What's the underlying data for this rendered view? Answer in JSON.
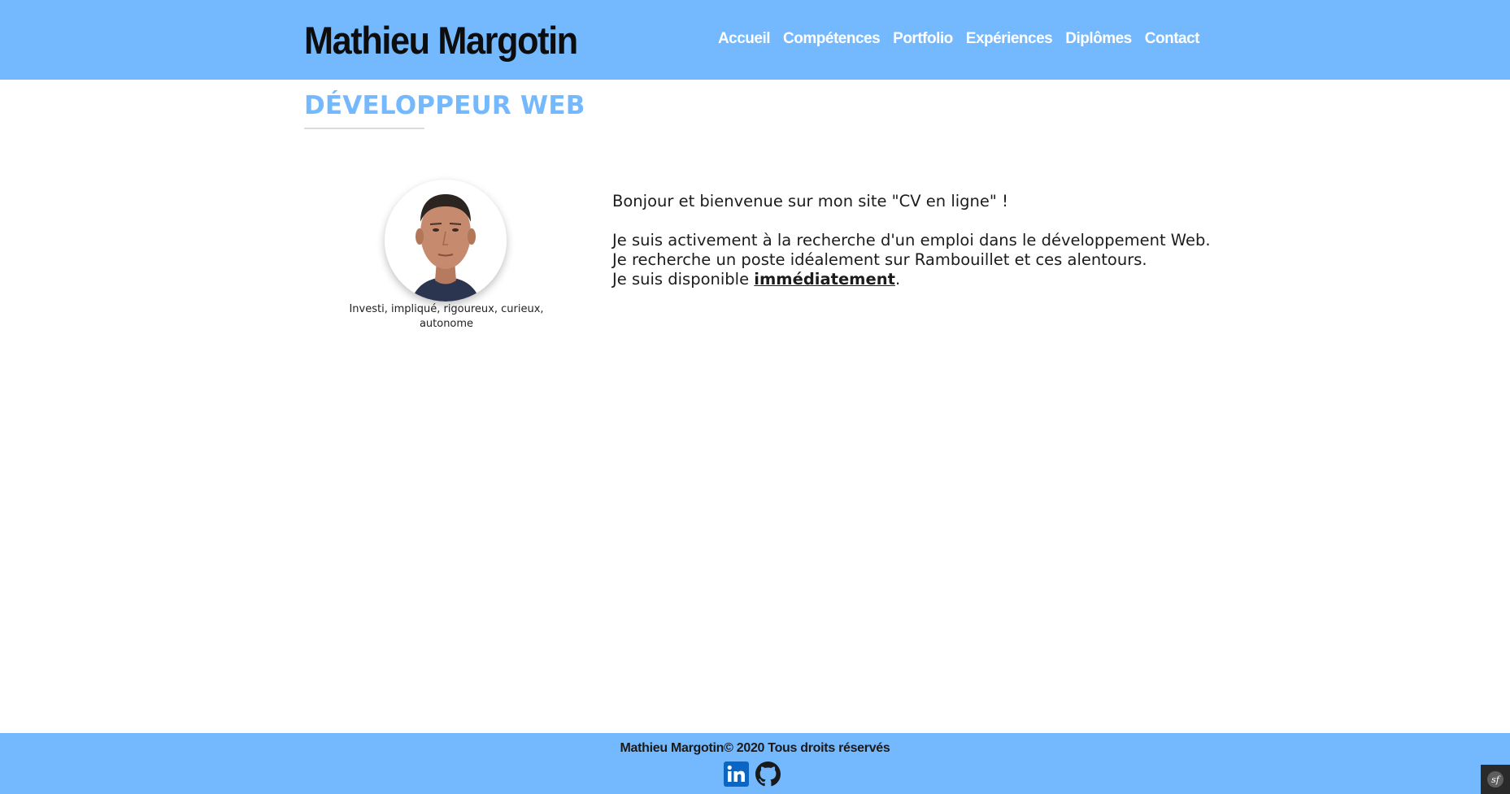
{
  "header": {
    "brand": "Mathieu Margotin",
    "nav": [
      {
        "label": "Accueil"
      },
      {
        "label": "Compétences"
      },
      {
        "label": "Portfolio"
      },
      {
        "label": "Expériences"
      },
      {
        "label": "Diplômes"
      },
      {
        "label": "Contact"
      }
    ]
  },
  "main": {
    "section_title": "DÉVELOPPEUR WEB",
    "avatar_caption": "Investi, impliqué, rigoureux, curieux, autonome",
    "intro": {
      "line1": "Bonjour et bienvenue sur mon site \"CV en ligne\" !",
      "line2": "Je suis activement à la recherche d'un emploi dans le développement Web.",
      "line3": "Je recherche un poste idéalement sur Rambouillet et ces alentours.",
      "line4_prefix": "Je suis disponible ",
      "line4_link": "immédiatement",
      "line4_suffix": "."
    }
  },
  "footer": {
    "copyright": "Mathieu Margotin© 2020 Tous droits réservés",
    "social": [
      {
        "icon": "linkedin-icon",
        "color": "#0a66c2"
      },
      {
        "icon": "github-icon",
        "color": "#1a1a1a"
      }
    ]
  },
  "colors": {
    "accent": "#74b8fd",
    "text": "#1c1c1c"
  }
}
